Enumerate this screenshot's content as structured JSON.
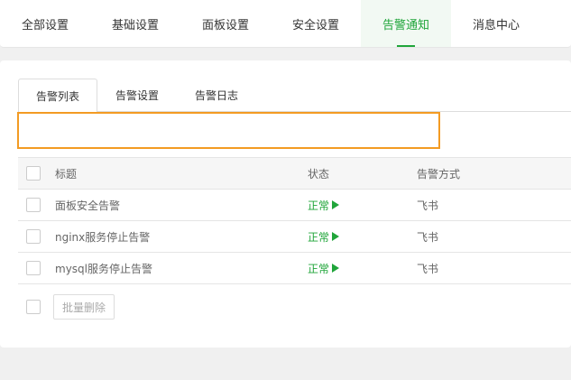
{
  "top_tabs": [
    {
      "label": "全部设置"
    },
    {
      "label": "基础设置"
    },
    {
      "label": "面板设置"
    },
    {
      "label": "安全设置"
    },
    {
      "label": "告警通知"
    },
    {
      "label": "消息中心"
    }
  ],
  "active_top_tab": "告警通知",
  "sub_tabs": [
    {
      "label": "告警列表"
    },
    {
      "label": "告警设置"
    },
    {
      "label": "告警日志"
    }
  ],
  "table": {
    "columns": [
      "标题",
      "状态",
      "告警方式"
    ],
    "rows": [
      {
        "title": "面板安全告警",
        "status": "正常",
        "method": "飞书"
      },
      {
        "title": "nginx服务停止告警",
        "status": "正常",
        "method": "飞书"
      },
      {
        "title": "mysql服务停止告警",
        "status": "正常",
        "method": "飞书"
      }
    ]
  },
  "batch_delete_label": "批量删除",
  "colors": {
    "accent": "#20a53a",
    "highlight": "#f39b23"
  }
}
